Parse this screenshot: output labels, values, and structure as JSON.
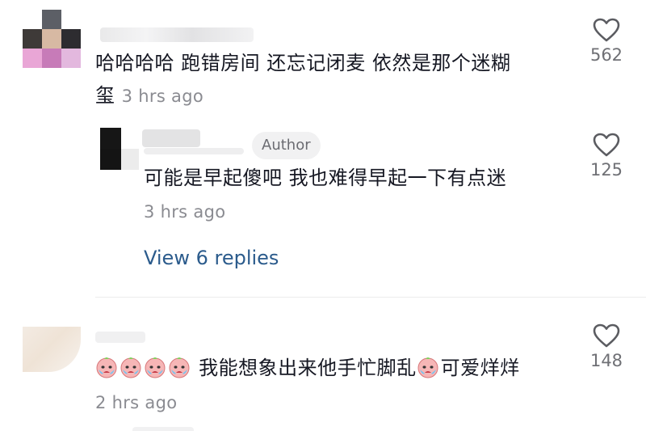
{
  "comments": [
    {
      "text": "哈哈哈哈 跑错房间 还忘记闭麦 依然是那个迷糊",
      "text_wrap": "玺",
      "time": "3 hrs ago",
      "likes": "562"
    },
    {
      "badge": "Author",
      "text": "可能是早起傻吧 我也难得早起一下有点迷",
      "time": "3 hrs ago",
      "likes": "125"
    },
    {
      "text": "我能想象出来他手忙脚乱",
      "text_end": "可爱烊烊",
      "time": "2 hrs ago",
      "likes": "148"
    }
  ],
  "view_replies": "View 6 replies",
  "icons": {
    "like": "heart-outline-icon",
    "emoji": "crying-face-emoji-icon"
  },
  "colors": {
    "link": "#2b5b8c",
    "muted": "#8a8b91",
    "text": "#161823"
  }
}
